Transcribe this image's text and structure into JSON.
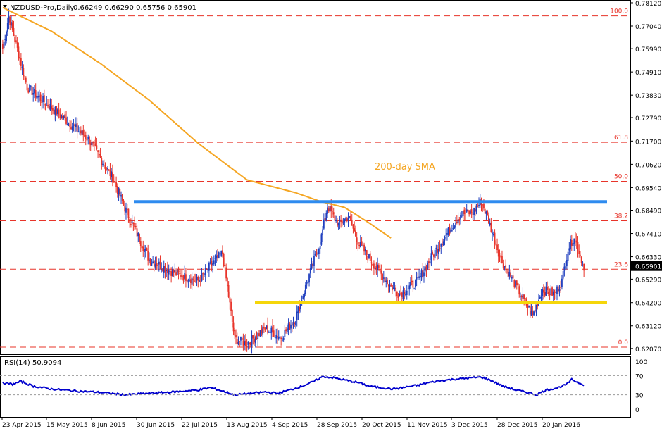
{
  "header": {
    "symbol": "NZDUSD-Pro,Daily",
    "ohlc": "0.66249 0.66290 0.65756 0.65901"
  },
  "chart_data": [
    {
      "type": "candlestick",
      "name": "price-panel",
      "ylim": [
        0.62,
        0.7825
      ],
      "price_ticks": [
        "0.78120",
        "0.77040",
        "0.75990",
        "0.74910",
        "0.73830",
        "0.72790",
        "0.71700",
        "0.70620",
        "0.69540",
        "0.68490",
        "0.67410",
        "0.66330",
        "0.65901",
        "0.65290",
        "0.64200",
        "0.63120",
        "0.62070"
      ],
      "current_price": "0.65901",
      "x_labels": [
        "23 Apr 2015",
        "15 May 2015",
        "8 Jun 2015",
        "30 Jun 2015",
        "22 Jul 2015",
        "13 Aug 2015",
        "4 Sep 2015",
        "28 Sep 2015",
        "20 Oct 2015",
        "11 Nov 2015",
        "3 Dec 2015",
        "28 Dec 2015",
        "20 Jan 2016"
      ],
      "fib_levels": [
        {
          "label": "100.0",
          "value": 0.7751
        },
        {
          "label": "61.8",
          "value": 0.7164
        },
        {
          "label": "50.0",
          "value": 0.6983
        },
        {
          "label": "38.2",
          "value": 0.68
        },
        {
          "label": "23.6",
          "value": 0.6575
        },
        {
          "label": "0.0",
          "value": 0.6213
        }
      ],
      "resistance_value": 0.6889,
      "support_value": 0.642,
      "sma_label": "200-day SMA",
      "sma_points": [
        [
          0,
          0.779
        ],
        [
          40,
          0.768
        ],
        [
          80,
          0.753
        ],
        [
          120,
          0.736
        ],
        [
          160,
          0.716
        ],
        [
          200,
          0.699
        ],
        [
          240,
          0.693
        ],
        [
          260,
          0.689
        ],
        [
          280,
          0.6862
        ],
        [
          300,
          0.679
        ],
        [
          318,
          0.672
        ]
      ],
      "key_points": [
        [
          0,
          0.76
        ],
        [
          5,
          0.775
        ],
        [
          20,
          0.742
        ],
        [
          45,
          0.73
        ],
        [
          70,
          0.718
        ],
        [
          90,
          0.7
        ],
        [
          100,
          0.686
        ],
        [
          120,
          0.662
        ],
        [
          140,
          0.656
        ],
        [
          160,
          0.652
        ],
        [
          170,
          0.659
        ],
        [
          180,
          0.665
        ],
        [
          190,
          0.625
        ],
        [
          200,
          0.623
        ],
        [
          215,
          0.63
        ],
        [
          228,
          0.626
        ],
        [
          240,
          0.635
        ],
        [
          250,
          0.653
        ],
        [
          260,
          0.67
        ],
        [
          266,
          0.687
        ],
        [
          275,
          0.678
        ],
        [
          283,
          0.682
        ],
        [
          292,
          0.669
        ],
        [
          305,
          0.659
        ],
        [
          317,
          0.65
        ],
        [
          325,
          0.646
        ],
        [
          340,
          0.652
        ],
        [
          352,
          0.664
        ],
        [
          365,
          0.675
        ],
        [
          375,
          0.683
        ],
        [
          385,
          0.684
        ],
        [
          392,
          0.689
        ],
        [
          398,
          0.68
        ],
        [
          408,
          0.662
        ],
        [
          418,
          0.652
        ],
        [
          428,
          0.642
        ],
        [
          434,
          0.636
        ],
        [
          442,
          0.648
        ],
        [
          452,
          0.646
        ],
        [
          458,
          0.652
        ],
        [
          463,
          0.667
        ],
        [
          468,
          0.673
        ],
        [
          473,
          0.664
        ],
        [
          476,
          0.659
        ]
      ],
      "candle_count": 477
    },
    {
      "type": "line",
      "name": "rsi-panel",
      "title": "RSI(14) 50.9094",
      "ylim": [
        0,
        100
      ],
      "ticks": [
        "100",
        "70",
        "30",
        "0"
      ],
      "levels": [
        70,
        30
      ],
      "key_points": [
        [
          0,
          55
        ],
        [
          8,
          52
        ],
        [
          15,
          58
        ],
        [
          25,
          48
        ],
        [
          40,
          42
        ],
        [
          60,
          38
        ],
        [
          80,
          35
        ],
        [
          100,
          30
        ],
        [
          120,
          33
        ],
        [
          140,
          36
        ],
        [
          160,
          40
        ],
        [
          170,
          45
        ],
        [
          180,
          38
        ],
        [
          190,
          30
        ],
        [
          200,
          32
        ],
        [
          215,
          36
        ],
        [
          225,
          33
        ],
        [
          235,
          40
        ],
        [
          245,
          48
        ],
        [
          255,
          58
        ],
        [
          262,
          68
        ],
        [
          270,
          66
        ],
        [
          278,
          62
        ],
        [
          286,
          58
        ],
        [
          292,
          55
        ],
        [
          300,
          48
        ],
        [
          310,
          45
        ],
        [
          320,
          42
        ],
        [
          330,
          46
        ],
        [
          340,
          50
        ],
        [
          350,
          56
        ],
        [
          360,
          60
        ],
        [
          372,
          63
        ],
        [
          382,
          65
        ],
        [
          392,
          67
        ],
        [
          400,
          60
        ],
        [
          410,
          48
        ],
        [
          420,
          40
        ],
        [
          430,
          35
        ],
        [
          437,
          30
        ],
        [
          445,
          40
        ],
        [
          455,
          45
        ],
        [
          462,
          52
        ],
        [
          466,
          62
        ],
        [
          472,
          55
        ],
        [
          476,
          51
        ]
      ]
    }
  ]
}
